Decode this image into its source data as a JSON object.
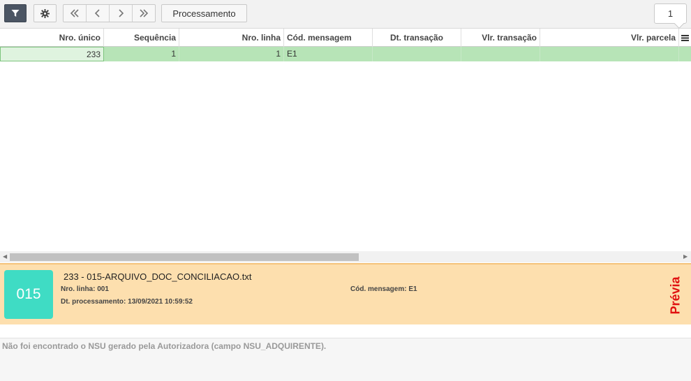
{
  "toolbar": {
    "filter_icon": "filter-icon",
    "settings_icon": "gear-icon",
    "nav_icons": [
      "double-chevron-left-icon",
      "chevron-left-icon",
      "chevron-right-icon",
      "double-chevron-right-icon"
    ],
    "processamento_label": "Processamento",
    "page_number": "1"
  },
  "grid": {
    "columns": [
      {
        "label": "Nro. único"
      },
      {
        "label": "Sequência"
      },
      {
        "label": "Nro. linha"
      },
      {
        "label": "Cód. mensagem"
      },
      {
        "label": "Dt. transação"
      },
      {
        "label": "Vlr. transação"
      },
      {
        "label": "Vlr. parcela"
      }
    ],
    "rows": [
      {
        "nro_unico": "233",
        "sequencia": "1",
        "nro_linha": "1",
        "cod_mensagem": "E1",
        "dt_transacao": "",
        "vlr_transacao": "",
        "vlr_parcela": ""
      }
    ],
    "row_color": "#b7e4b7"
  },
  "card": {
    "badge": "015",
    "badge_color": "#3fdcc4",
    "title": "233 - 015-ARQUIVO_DOC_CONCILIACAO.txt",
    "nro_linha": "Nro. linha: 001",
    "cod_mensagem": "Cód. mensagem: E1",
    "dt_processamento": "Dt. processamento: 13/09/2021 10:59:52",
    "status": "Prévia",
    "status_color": "#e01010",
    "background_color": "#fddfae"
  },
  "message": "Não foi encontrado o NSU gerado pela Autorizadora (campo NSU_ADQUIRENTE)."
}
